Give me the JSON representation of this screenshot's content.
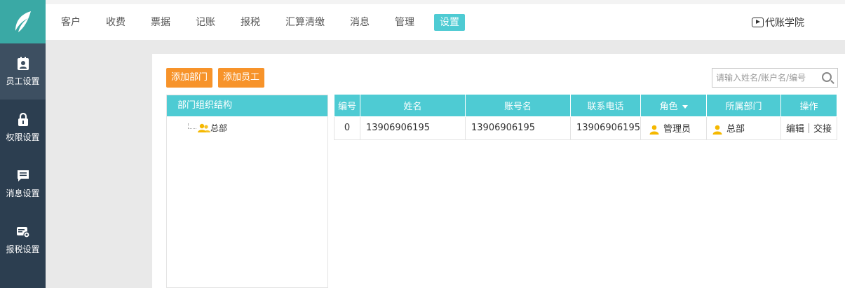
{
  "nav": {
    "items": [
      {
        "label": "客户"
      },
      {
        "label": "收费"
      },
      {
        "label": "票据"
      },
      {
        "label": "记账"
      },
      {
        "label": "报税"
      },
      {
        "label": "汇算清缴"
      },
      {
        "label": "消息"
      },
      {
        "label": "管理"
      },
      {
        "label": "设置",
        "active": true
      }
    ],
    "academy_label": "代账学院"
  },
  "sidebar": {
    "items": [
      {
        "label": "员工设置",
        "icon": "id-badge-icon",
        "active": true
      },
      {
        "label": "权限设置",
        "icon": "lock-icon"
      },
      {
        "label": "消息设置",
        "icon": "message-icon"
      },
      {
        "label": "报税设置",
        "icon": "tax-card-icon"
      }
    ]
  },
  "toolbar": {
    "add_dept_label": "添加部门",
    "add_staff_label": "添加员工",
    "search_placeholder": "请输入姓名/账户名/编号"
  },
  "tree": {
    "title": "部门组织结构",
    "root_label": "总部"
  },
  "table": {
    "headers": [
      "编号",
      "姓名",
      "账号名",
      "联系电话",
      "角色",
      "所属部门",
      "操作"
    ],
    "rows": [
      {
        "id": "0",
        "name": "13906906195",
        "account": "13906906195",
        "phone": "13906906195",
        "role": "管理员",
        "dept": "总部",
        "edit_label": "编辑",
        "handover_label": "交接"
      }
    ]
  },
  "colors": {
    "accent": "#4ecbd3",
    "button": "#f7932a",
    "sidebar_bg": "#2c3e50",
    "logo_bg": "#3aa9a5",
    "user_icon": "#f5b800"
  }
}
